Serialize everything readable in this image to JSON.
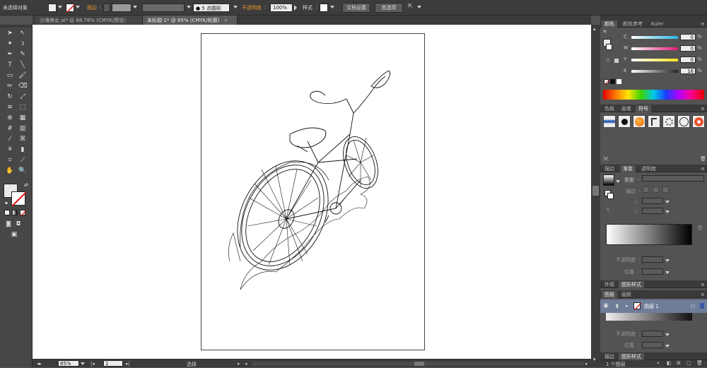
{
  "control_bar": {
    "selection_status": "未选择对象",
    "stroke_label": "描边",
    "stroke_weight": "",
    "brush_value": "5 点圆形",
    "opacity_label": "不透明度",
    "opacity_value": "100%",
    "style_label": "样式",
    "doc_setup_button": "文档设置",
    "preferences_button": "首选项"
  },
  "document_tabs": [
    {
      "label": "沙滩美女.ai* @ 88.76% (CMYK/预览)",
      "active": false
    },
    {
      "label": "未标题-1* @ 85% (CMYK/轮廓)",
      "active": true
    }
  ],
  "status_bar": {
    "zoom": "85%",
    "page": "1",
    "tool_status": "选择"
  },
  "color_panel": {
    "tabs": [
      "颜色",
      "颜色参考",
      "Kuler"
    ],
    "channels": [
      {
        "label": "C",
        "value": "0",
        "color": "#29b6e8"
      },
      {
        "label": "M",
        "value": "0",
        "color": "#e6177a"
      },
      {
        "label": "Y",
        "value": "0",
        "color": "#f4e21a"
      },
      {
        "label": "K",
        "value": "16",
        "color": "#222222"
      }
    ]
  },
  "symbols_panel": {
    "tabs": [
      "色板",
      "画笔",
      "符号"
    ]
  },
  "gradient_panel": {
    "tabs": [
      "描边",
      "渐变",
      "透明度"
    ],
    "type_label": "类型",
    "stroke_label": "描边",
    "opacity_label": "不透明度",
    "position_label": "位置"
  },
  "appearance_panel": {
    "tabs": [
      "外观",
      "图形样式"
    ]
  },
  "layers_panel": {
    "tabs": [
      "图层",
      "画板"
    ],
    "layer_name": "图层 1",
    "opacity_label": "不透明度",
    "position_label": "位置",
    "layer_count": "1 个图层"
  },
  "bottom_tabs": [
    "描边",
    "图形样式"
  ]
}
